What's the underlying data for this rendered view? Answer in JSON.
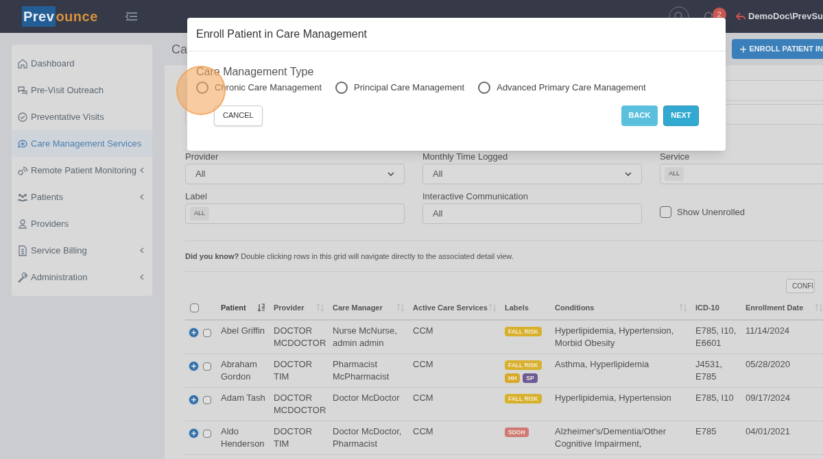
{
  "topbar": {
    "logo": {
      "first": "Prev",
      "second": "ounce"
    },
    "notification_count": "2",
    "user": "DemoDoc\\PrevSu"
  },
  "sidebar": {
    "items": [
      {
        "label": "Dashboard",
        "selected": false,
        "expandable": false
      },
      {
        "label": "Pre-Visit Outreach",
        "selected": false,
        "expandable": false
      },
      {
        "label": "Preventative Visits",
        "selected": false,
        "expandable": false
      },
      {
        "label": "Care Management Services",
        "selected": true,
        "expandable": false
      },
      {
        "label": "Remote Patient Monitoring",
        "selected": false,
        "expandable": true
      },
      {
        "label": "Patients",
        "selected": false,
        "expandable": true
      },
      {
        "label": "Providers",
        "selected": false,
        "expandable": false
      },
      {
        "label": "Service Billing",
        "selected": false,
        "expandable": true
      },
      {
        "label": "Administration",
        "selected": false,
        "expandable": true
      }
    ]
  },
  "page_title": "Ca",
  "enroll_button": "ENROLL PATIENT IN",
  "filters": [
    {
      "label": "Provider",
      "kind": "select",
      "value": "All"
    },
    {
      "label": "Monthly Time Logged",
      "kind": "select",
      "value": "All"
    },
    {
      "label": "Service",
      "kind": "tags",
      "value": "ALL"
    },
    {
      "label": "Label",
      "kind": "tags",
      "value": "ALL"
    },
    {
      "label": "Interactive Communication",
      "kind": "text",
      "value": "All"
    },
    {
      "label": "Show Unenrolled",
      "kind": "checkbox",
      "checked": false
    }
  ],
  "tip": "**Did you know?** Double clicking rows in this grid will navigate directly to the associated detail view.",
  "config_button": "CONFI",
  "table": {
    "columns": [
      {
        "label": "Patient",
        "sortable": true,
        "sorted": true
      },
      {
        "label": "Provider",
        "sortable": true,
        "sorted": false
      },
      {
        "label": "Care Manager",
        "sortable": true,
        "sorted": false
      },
      {
        "label": "Active Care Services",
        "sortable": true,
        "sorted": false
      },
      {
        "label": "Labels",
        "sortable": false
      },
      {
        "label": "Conditions",
        "sortable": true,
        "sorted": false
      },
      {
        "label": "ICD-10",
        "sortable": false
      },
      {
        "label": "Enrollment Date",
        "sortable": true,
        "sorted": false
      }
    ],
    "select_all_checked": false,
    "rows": [
      {
        "checked": false,
        "patient": "Abel Griffin",
        "provider": "DOCTOR MCDOCTOR",
        "care_manager": "Nurse McNurse, admin admin",
        "services": "CCM",
        "labels": [
          {
            "text": "FALL RISK",
            "color": "#d8b02c"
          }
        ],
        "conditions": "Hyperlipidemia, Hypertension, Morbid Obesity",
        "icd10": "E785, I10, E6601",
        "enrollment_date": "11/14/2024"
      },
      {
        "checked": false,
        "patient": "Abraham Gordon",
        "provider": "DOCTOR TIM",
        "care_manager": "Pharmacist McPharmacist",
        "services": "CCM",
        "labels": [
          {
            "text": "FALL RISK",
            "color": "#d8b02c"
          },
          {
            "text": "HH",
            "color": "#d8a82a"
          },
          {
            "text": "SP",
            "color": "#6c5a96"
          }
        ],
        "conditions": "Asthma, Hyperlipidemia",
        "icd10": "J4531, E785",
        "enrollment_date": "05/28/2020"
      },
      {
        "checked": false,
        "patient": "Adam Tash",
        "provider": "DOCTOR MCDOCTOR",
        "care_manager": "Doctor McDoctor",
        "services": "CCM",
        "labels": [
          {
            "text": "FALL RISK",
            "color": "#d8b02c"
          }
        ],
        "conditions": "Hyperlipidemia, Hypertension",
        "icd10": "E785, I10",
        "enrollment_date": "09/17/2024"
      },
      {
        "checked": false,
        "patient": "Aldo Henderson",
        "provider": "DOCTOR TIM",
        "care_manager": "Doctor McDoctor, Pharmacist",
        "services": "CCM",
        "labels": [
          {
            "text": "SDOH",
            "color": "#cf7a77"
          }
        ],
        "conditions": "Alzheimer's/Dementia/Other Cognitive Impairment,",
        "icd10": "E785",
        "enrollment_date": "04/01/2021"
      }
    ]
  },
  "modal": {
    "title": "Enroll Patient in Care Management",
    "section_label": "Care Management Type",
    "options": [
      {
        "label": "Chronic Care Management",
        "selected": false
      },
      {
        "label": "Principal Care Management",
        "selected": false
      },
      {
        "label": "Advanced Primary Care Management",
        "selected": false
      }
    ],
    "cancel_button": "CANCEL",
    "back_button": "BACK",
    "next_button": "NEXT"
  }
}
